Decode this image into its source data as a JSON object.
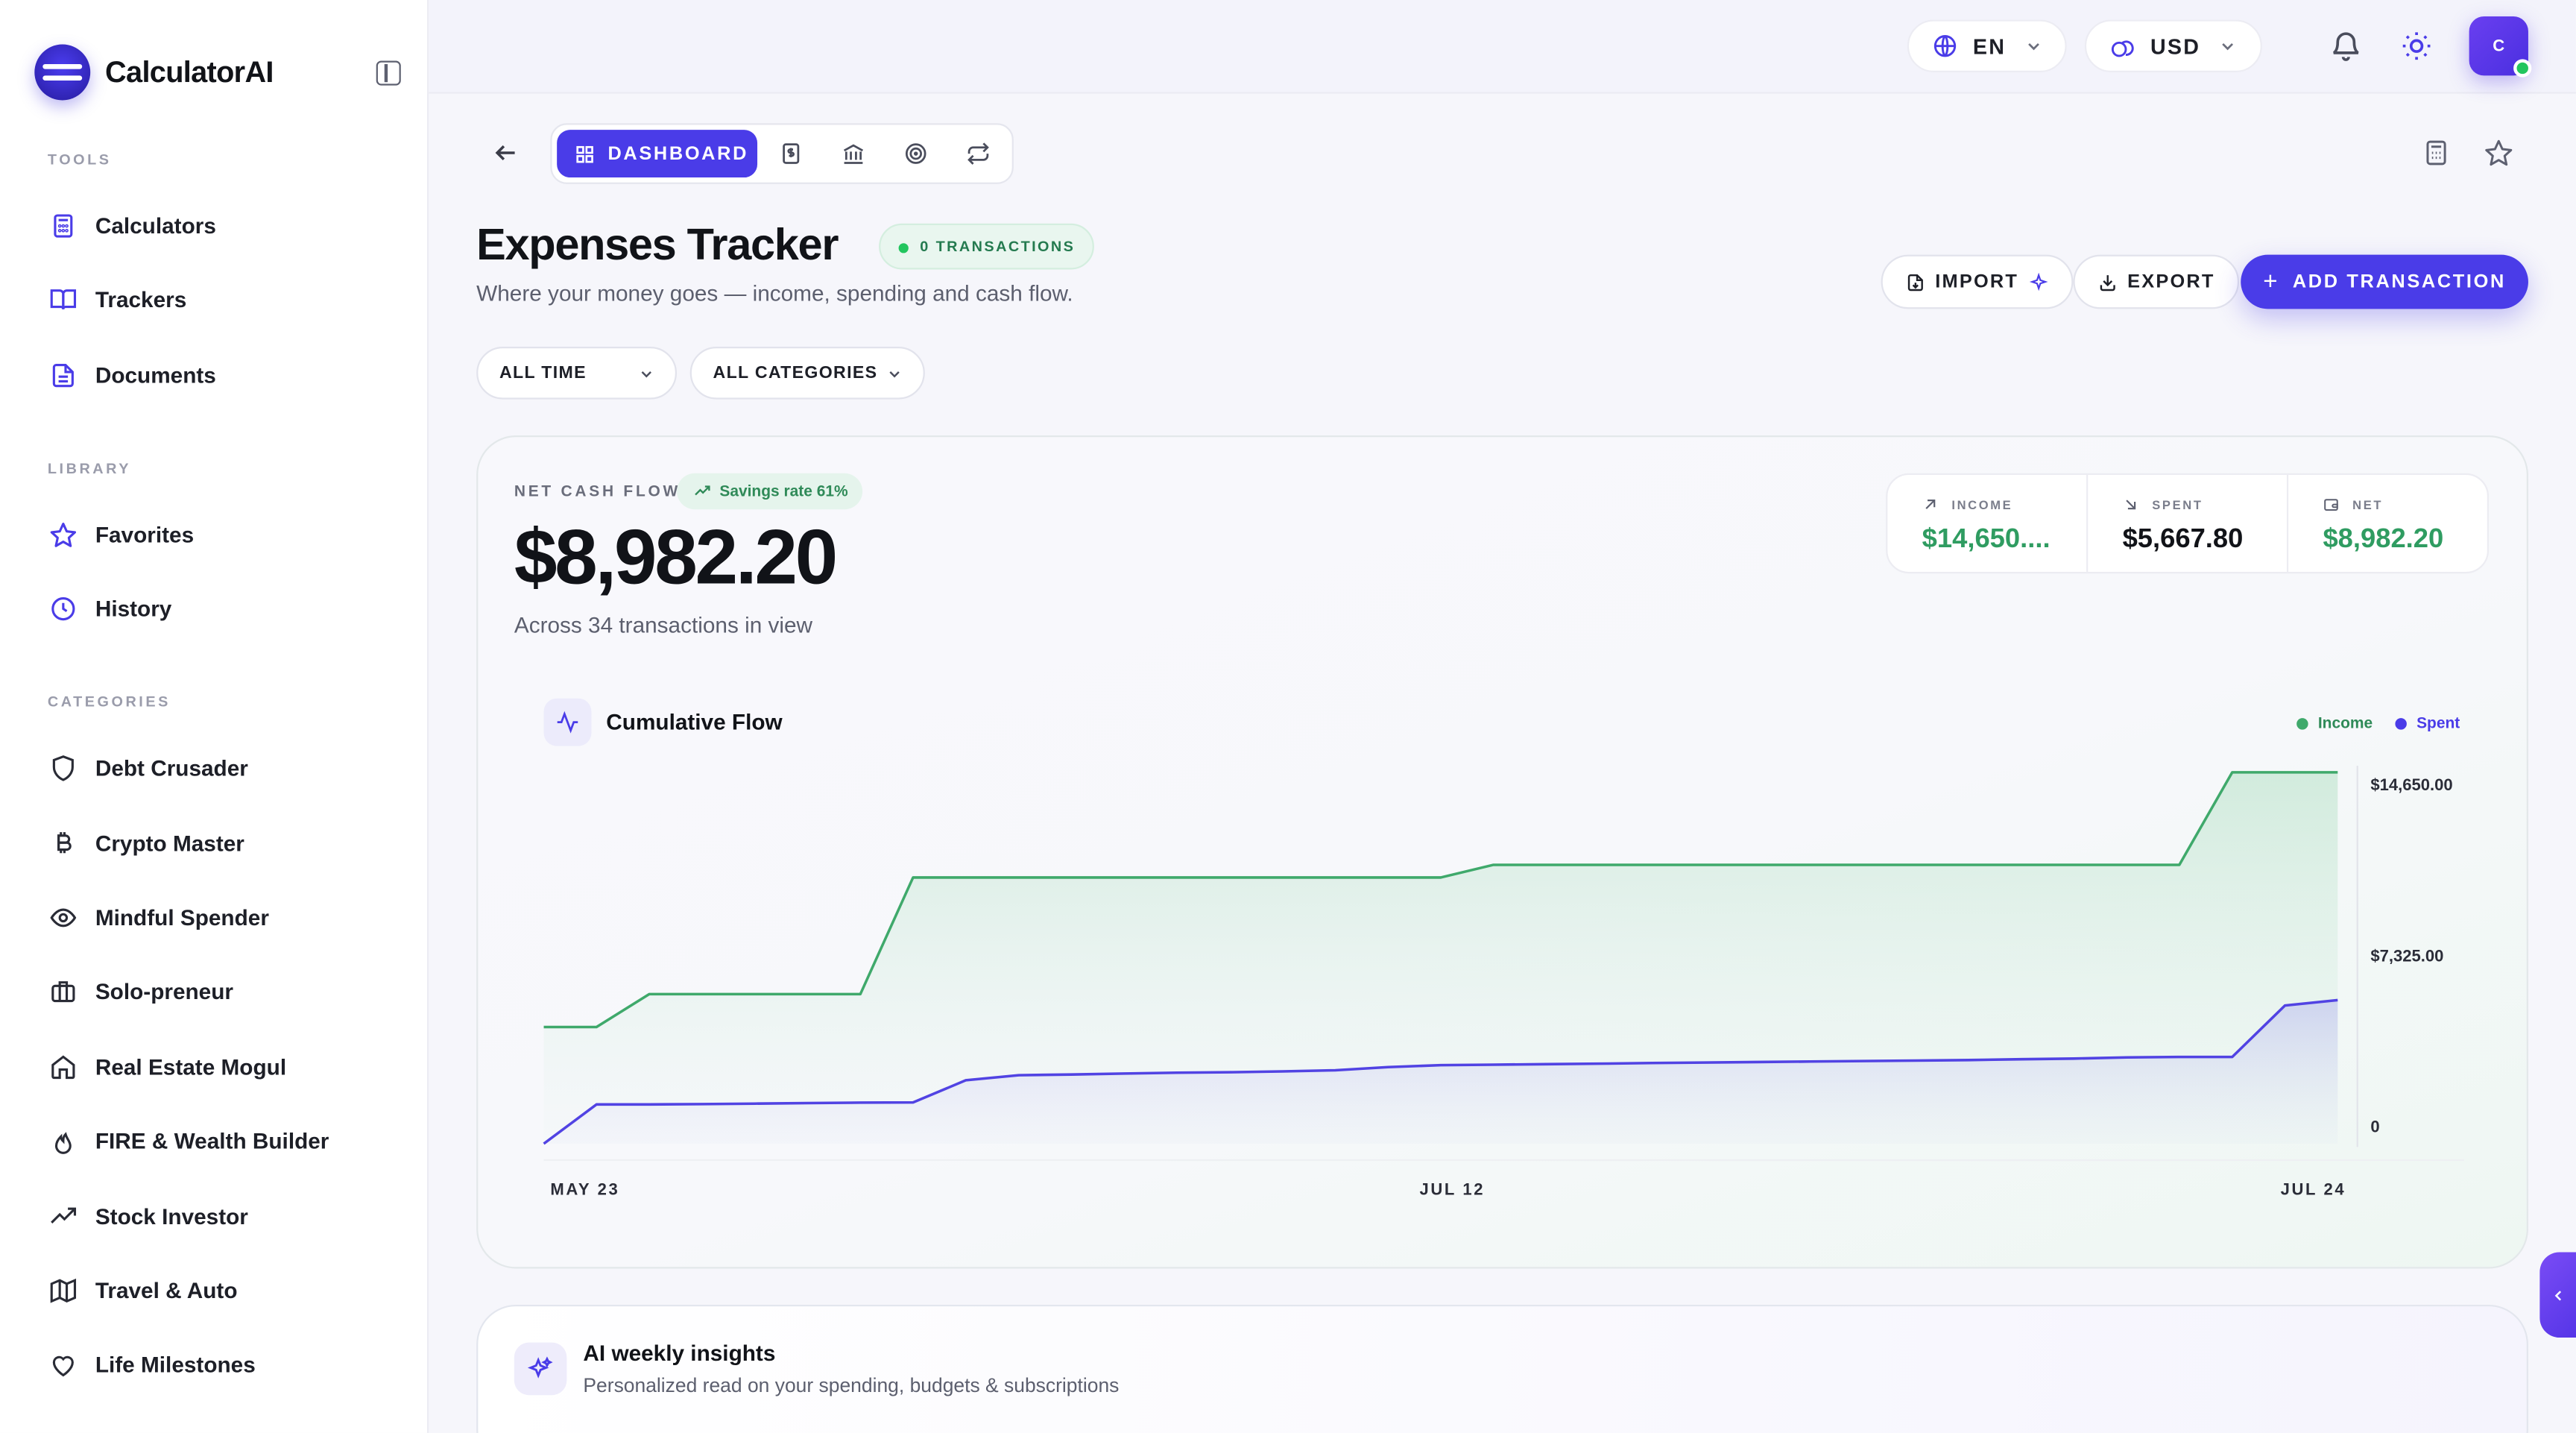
{
  "brand": {
    "name": "CalculatorAI"
  },
  "sidebar": {
    "sections": {
      "tools": "TOOLS",
      "library": "LIBRARY",
      "categories": "CATEGORIES"
    },
    "tools": [
      {
        "label": "Calculators",
        "icon": "calculator-icon"
      },
      {
        "label": "Trackers",
        "icon": "book-open-icon"
      },
      {
        "label": "Documents",
        "icon": "document-icon"
      }
    ],
    "library": [
      {
        "label": "Favorites",
        "icon": "star-icon"
      },
      {
        "label": "History",
        "icon": "clock-icon"
      }
    ],
    "categories": [
      {
        "label": "Debt Crusader",
        "icon": "shield-icon"
      },
      {
        "label": "Crypto Master",
        "icon": "bitcoin-icon"
      },
      {
        "label": "Mindful Spender",
        "icon": "eye-icon"
      },
      {
        "label": "Solo-preneur",
        "icon": "briefcase-icon"
      },
      {
        "label": "Real Estate Mogul",
        "icon": "home-icon"
      },
      {
        "label": "FIRE & Wealth Builder",
        "icon": "flame-icon"
      },
      {
        "label": "Stock Investor",
        "icon": "trending-up-icon"
      },
      {
        "label": "Travel & Auto",
        "icon": "map-icon"
      },
      {
        "label": "Life Milestones",
        "icon": "heart-icon"
      }
    ]
  },
  "topbar": {
    "language": "EN",
    "currency": "USD",
    "avatar_initial": "C"
  },
  "tabs": {
    "active_label": "DASHBOARD",
    "other_icons": [
      "dollar-document-icon",
      "bank-icon",
      "target-icon",
      "repeat-icon"
    ]
  },
  "page": {
    "title": "Expenses Tracker",
    "badge": "0 TRANSACTIONS",
    "subtitle": "Where your money goes — income, spending and cash flow.",
    "import_label": "IMPORT",
    "export_label": "EXPORT",
    "add_label": "ADD TRANSACTION"
  },
  "filters": {
    "time": "ALL TIME",
    "category": "ALL CATEGORIES"
  },
  "summary": {
    "label": "NET CASH FLOW",
    "savings_badge": "Savings rate 61%",
    "amount": "$8,982.20",
    "caption": "Across 34 transactions in view",
    "stats": [
      {
        "label": "INCOME",
        "value": "$14,650....",
        "color": "#2f9c61",
        "icon": "arrow-up-right-icon"
      },
      {
        "label": "SPENT",
        "value": "$5,667.80",
        "color": "#111318",
        "icon": "arrow-down-right-icon"
      },
      {
        "label": "NET",
        "value": "$8,982.20",
        "color": "#2f9c61",
        "icon": "wallet-icon"
      }
    ]
  },
  "chart_data": {
    "type": "area",
    "title": "Cumulative Flow",
    "x_tick_labels": [
      "MAY 23",
      "JUL 12",
      "JUL 24"
    ],
    "y_tick_labels": [
      "$14,650.00",
      "$7,325.00",
      "0"
    ],
    "ylim": [
      0,
      14650
    ],
    "legend_position": "top-right",
    "series": [
      {
        "name": "Income",
        "color": "#3fa96b",
        "values": [
          4600,
          4600,
          5900,
          5900,
          5900,
          5900,
          5900,
          10500,
          10500,
          10500,
          10500,
          10500,
          10500,
          10500,
          10500,
          10500,
          10500,
          10500,
          11000,
          11000,
          11000,
          11000,
          11000,
          11000,
          11000,
          11000,
          11000,
          11000,
          11000,
          11000,
          11000,
          11000,
          14650,
          14650,
          14650
        ]
      },
      {
        "name": "Spent",
        "color": "#5143e3",
        "values": [
          0,
          1550,
          1550,
          1560,
          1580,
          1600,
          1620,
          1630,
          2500,
          2700,
          2730,
          2770,
          2800,
          2820,
          2850,
          2900,
          3020,
          3100,
          3120,
          3140,
          3160,
          3180,
          3200,
          3220,
          3240,
          3260,
          3280,
          3300,
          3330,
          3360,
          3400,
          3420,
          3420,
          5450,
          5667.8
        ]
      }
    ]
  },
  "insights": {
    "title": "AI weekly insights",
    "subtitle": "Personalized read on your spending, budgets & subscriptions"
  }
}
